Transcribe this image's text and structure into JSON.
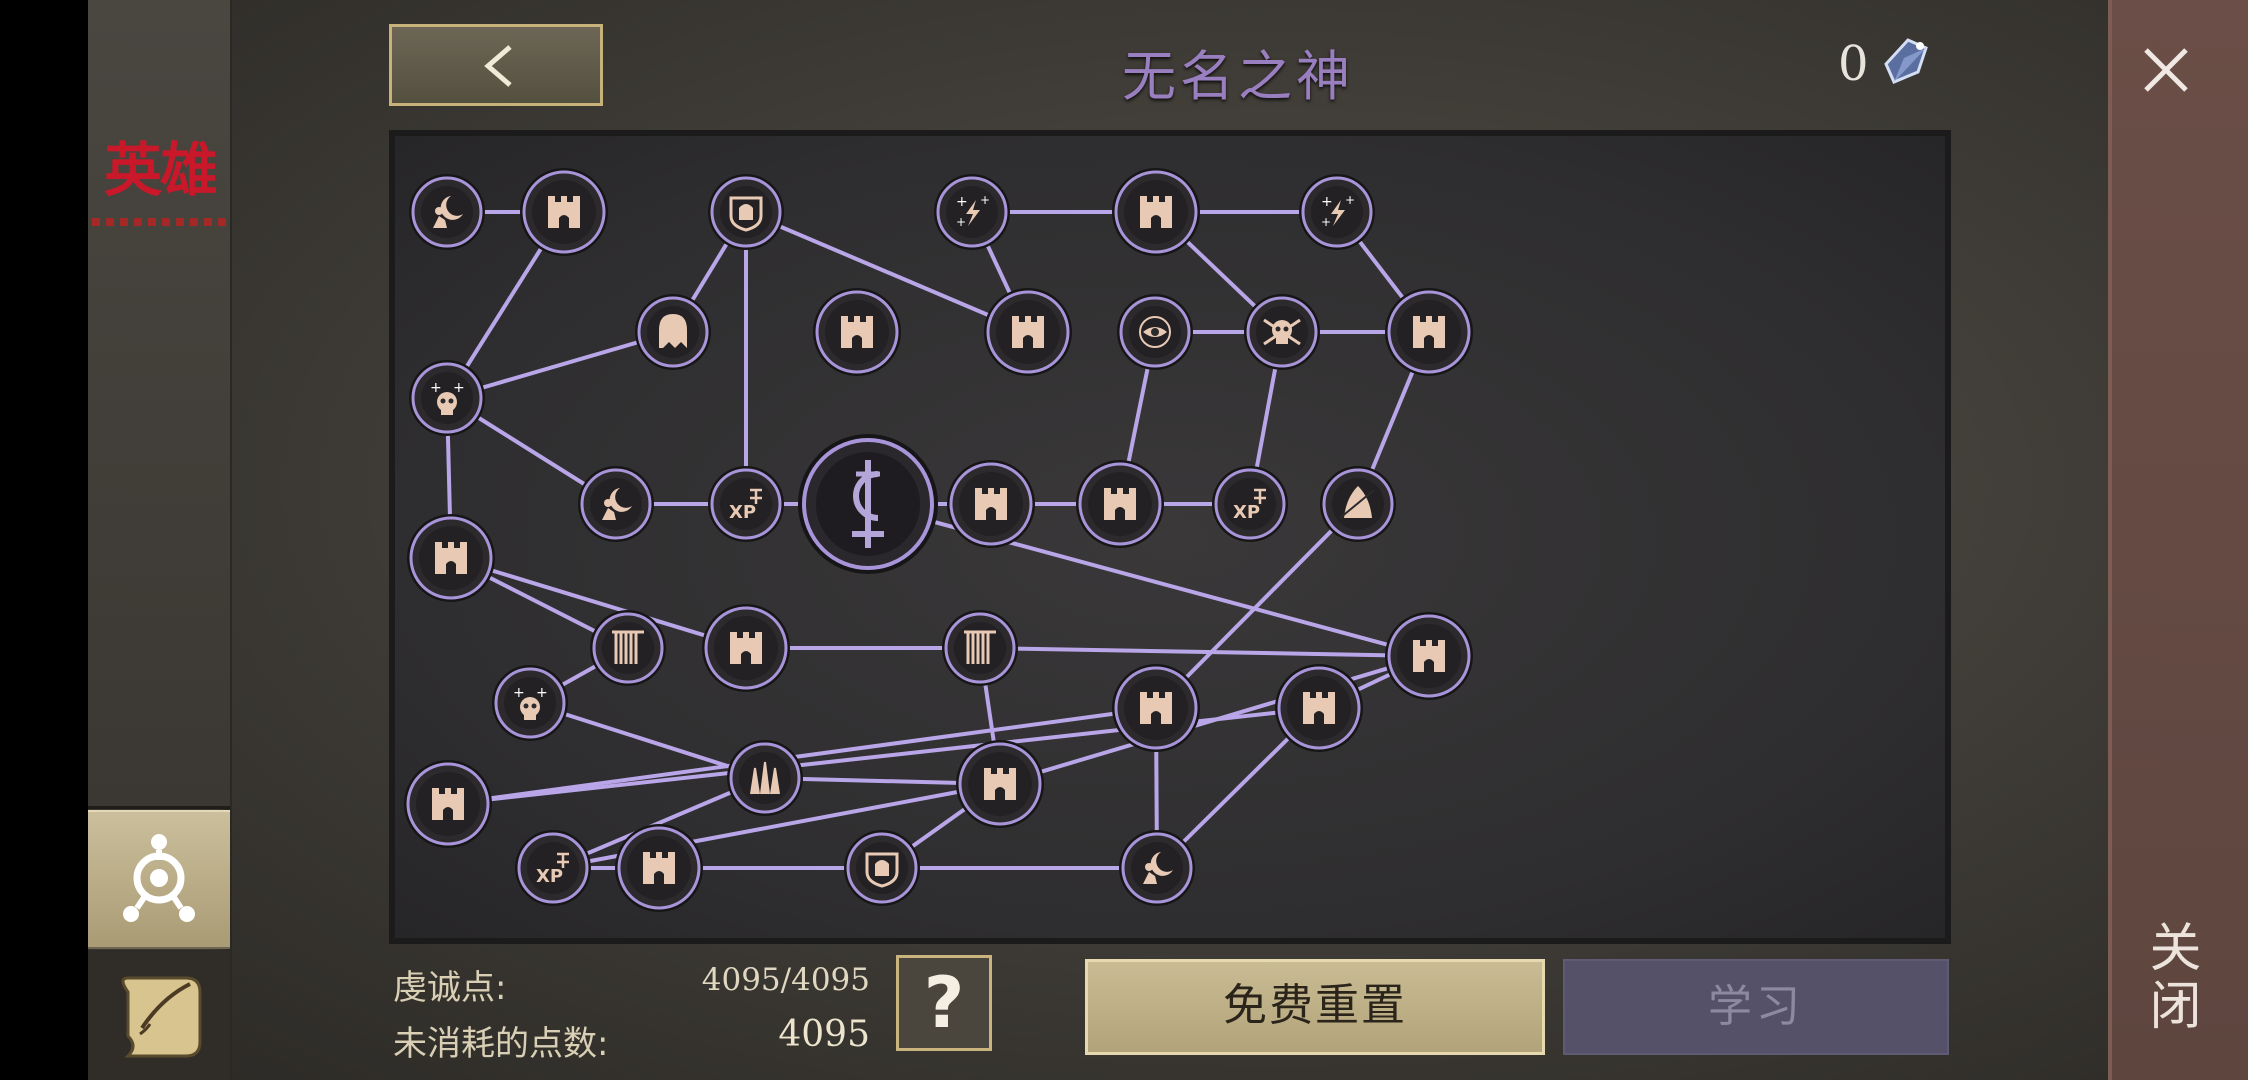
{
  "header": {
    "title": "无名之神",
    "gem_count": "0"
  },
  "sidebar": {
    "logo_text": "英雄",
    "tabs": [
      {
        "name": "talent-tab",
        "icon": "trinity-node-icon",
        "active": true
      },
      {
        "name": "scroll-tab",
        "icon": "scroll-quill-icon",
        "active": false
      }
    ]
  },
  "right_panel": {
    "close_label": "关闭"
  },
  "footer": {
    "piety_label": "虔诚点:",
    "piety_value": "4095/4095",
    "unspent_label": "未消耗的点数:",
    "unspent_value": "4095",
    "help_label": "?",
    "reset_label": "免费重置",
    "learn_label": "学习"
  },
  "tree": {
    "center_icon": "deity-symbol-icon",
    "node_icons": [
      "moon-figure-icon",
      "castle-icon",
      "gate-shield-icon",
      "lightning-stars-icon",
      "castle-icon",
      "lightning-stars-icon",
      "ghost-icon",
      "castle-icon",
      "castle-icon",
      "eye-target-icon",
      "skull-crossbones-icon",
      "castle-icon",
      "skull-plus-icon",
      "moon-figure-icon",
      "xp-icon",
      "castle-icon",
      "castle-icon",
      "xp-icon",
      "hooded-reaper-icon",
      "castle-icon",
      "rain-curtain-icon",
      "castle-icon",
      "rain-curtain-icon",
      "castle-icon",
      "skull-plus-icon",
      "castle-icon",
      "castle-icon",
      "castle-icon",
      "claw-icon",
      "castle-icon",
      "xp-icon",
      "castle-icon",
      "gate-shield-icon",
      "moon-figure-icon",
      "skull-crossbones-icon"
    ]
  },
  "colors": {
    "link": "#b9a6e8",
    "node_ring": "#a894d8",
    "icon": "#e8c9b4",
    "title": "#9a7fc0",
    "accent_gold": "#c9b47e"
  }
}
